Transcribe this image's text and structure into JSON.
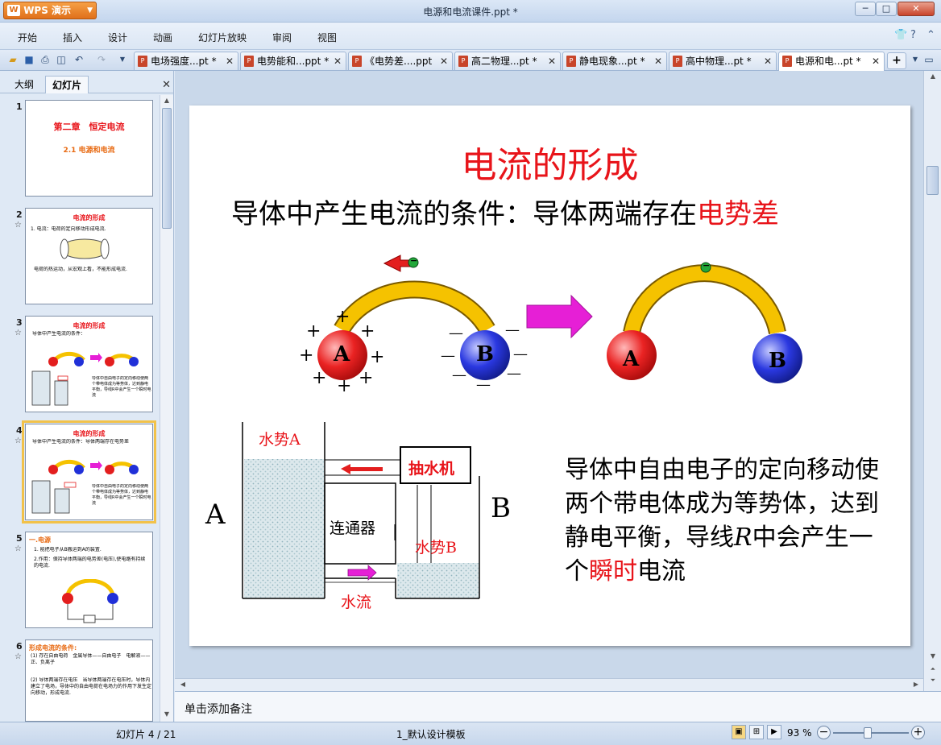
{
  "app": {
    "logo": "WPS 演示",
    "document_title": "电源和电流课件.ppt *",
    "window_controls": {
      "minimize": "─",
      "maximize": "□",
      "close": "✕"
    }
  },
  "menu": {
    "items": [
      "开始",
      "插入",
      "设计",
      "动画",
      "幻灯片放映",
      "审阅",
      "视图"
    ]
  },
  "tabs": [
    {
      "label": "电场强度...pt *",
      "close": "✕"
    },
    {
      "label": "电势能和...ppt *",
      "close": "✕"
    },
    {
      "label": "《电势差....ppt",
      "close": "✕"
    },
    {
      "label": "高二物理...pt *",
      "close": "✕"
    },
    {
      "label": "静电现象...pt *",
      "close": "✕"
    },
    {
      "label": "高中物理...pt *",
      "close": "✕"
    },
    {
      "label": "电源和电...pt *",
      "close": "✕",
      "active": true
    }
  ],
  "left_panel": {
    "tab_outline": "大纲",
    "tab_slides": "幻灯片",
    "close": "✕"
  },
  "thumbnails": [
    {
      "num": "1",
      "title": "第二章　恒定电流",
      "sub": "2.1 电源和电流"
    },
    {
      "num": "2",
      "title": "电流的形成",
      "line1": "1. 电流：电荷的定向移动形成电流.",
      "line2": "电荷的热运动，从宏观上看，不能形成电流."
    },
    {
      "num": "3",
      "title": "电流的形成",
      "line1": "导体中产生电流的条件：",
      "line2": "导体中自由电子的定向移动使两个带电体成为等势体，达到静电平衡，导线R中会产生一个瞬时电流"
    },
    {
      "num": "4",
      "title": "电流的形成",
      "line1": "导体中产生电流的条件：导体两端存在电势差",
      "line2": "导体中自由电子的定向移动使两个带电体成为等势体，达到静电平衡，导线R中会产生一个瞬时电流",
      "selected": true
    },
    {
      "num": "5",
      "title": "一.电源",
      "line1": "1. 能把电子从B搬运到A的装置.",
      "line2": "2.作用：保持导体两端的电势差(电压),使电路有持续的电流."
    },
    {
      "num": "6",
      "title": "形成电流的条件:",
      "line1": "(1) 存在自由电荷　金属导体——自由电子　电解液——正、负离子",
      "line2": "(2) 导体两端存在电压　当导体两端存在电压时，导体内建立了电场，导体中的自由电荷在电场力的作用下发生定向移动，形成电流."
    }
  ],
  "slide": {
    "title": "电流的形成",
    "subtitle_prefix": "导体中产生电流的条件：导体两端存在",
    "subtitle_red": "电势差",
    "sphere_a": "A",
    "sphere_b": "B",
    "neg_charge": "−",
    "plus_sign": "+",
    "minus_sign": "—",
    "water_a": "水势A",
    "water_b": "水势B",
    "pump": "抽水机",
    "connector": "连通器",
    "water_flow": "水流",
    "label_a": "A",
    "label_b": "B",
    "para_1": "导体中自由电子的定向移动使两个带电体成为等势体，达到静电平衡，导线",
    "para_r": "R",
    "para_2": "中会产生一个",
    "para_red": "瞬时",
    "para_3": "电流"
  },
  "notes_placeholder": "单击添加备注",
  "status": {
    "slide_counter": "幻灯片 4 / 21",
    "template": "1_默认设计模板",
    "zoom": "93 %"
  },
  "colors": {
    "accent_red": "#e8141a",
    "arc_gold": "#f5c200",
    "sphere_red": "#e31e1e",
    "sphere_blue": "#2030d8",
    "arrow_magenta": "#e61fd6"
  }
}
